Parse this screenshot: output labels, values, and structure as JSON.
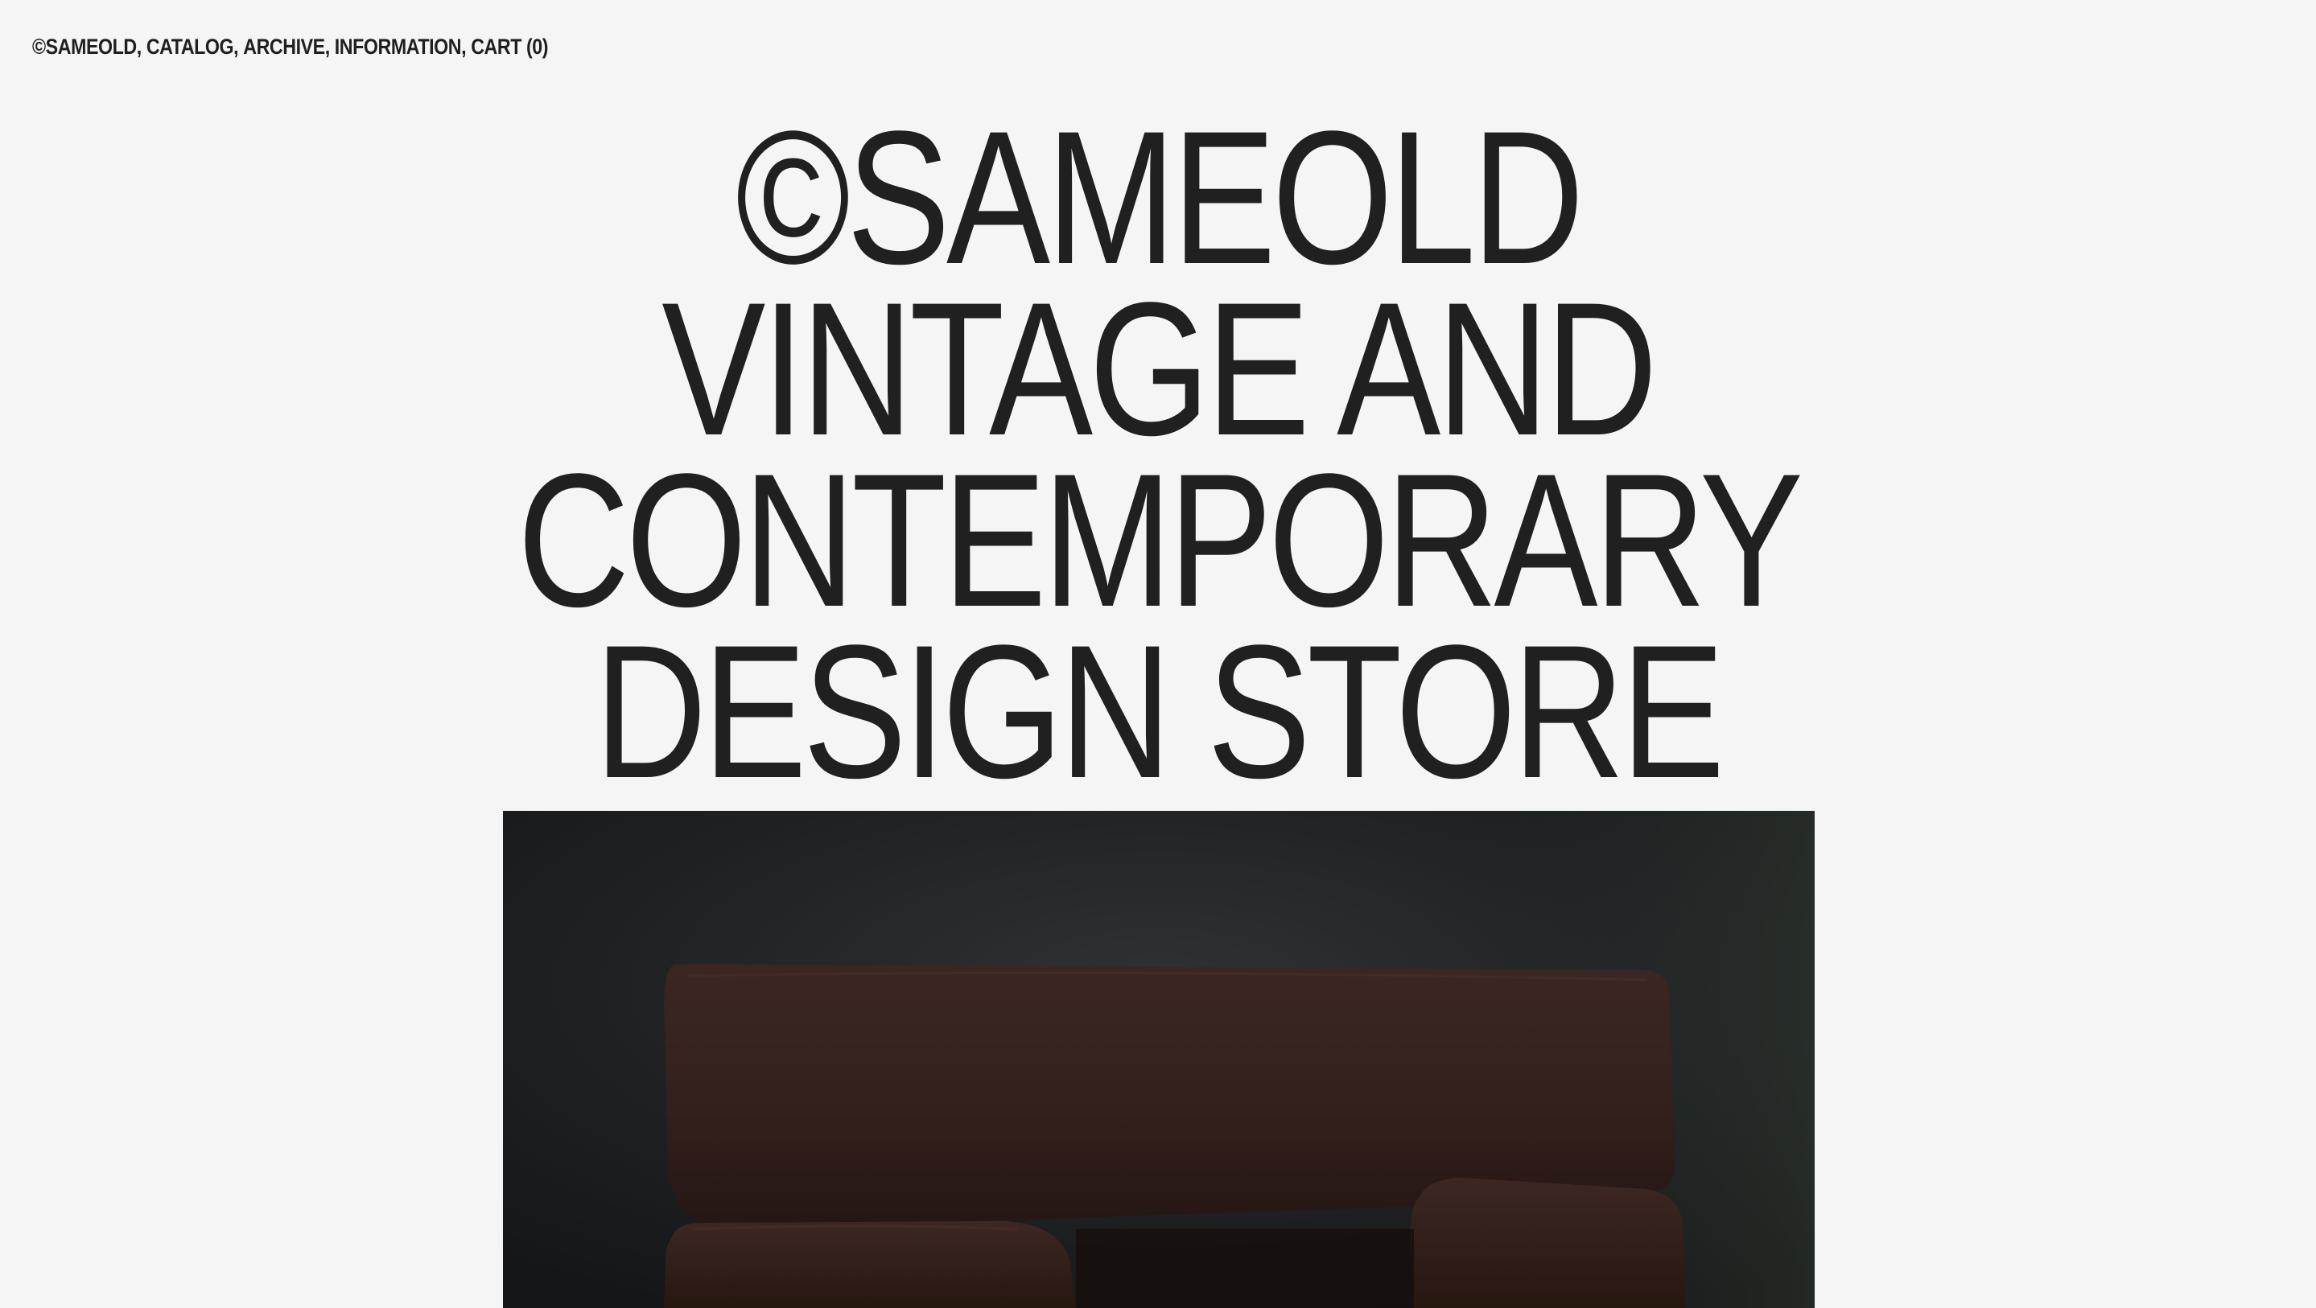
{
  "nav": {
    "items": [
      {
        "label": "©SAMEOLD",
        "name": "nav-home-link"
      },
      {
        "label": "CATALOG",
        "name": "nav-catalog-link"
      },
      {
        "label": "ARCHIVE",
        "name": "nav-archive-link"
      },
      {
        "label": "INFORMATION",
        "name": "nav-information-link"
      },
      {
        "label": "CART (0)",
        "name": "nav-cart-link"
      }
    ],
    "separator": ", "
  },
  "hero": {
    "lines": [
      "©SAMEOLD",
      "VINTAGE AND",
      "CONTEMPORARY",
      "DESIGN STORE"
    ]
  },
  "image": {
    "subject": "brown-upholstered-lounge-chair",
    "background_color": "#1c1e20",
    "upholstery_color": "#3a2420"
  }
}
